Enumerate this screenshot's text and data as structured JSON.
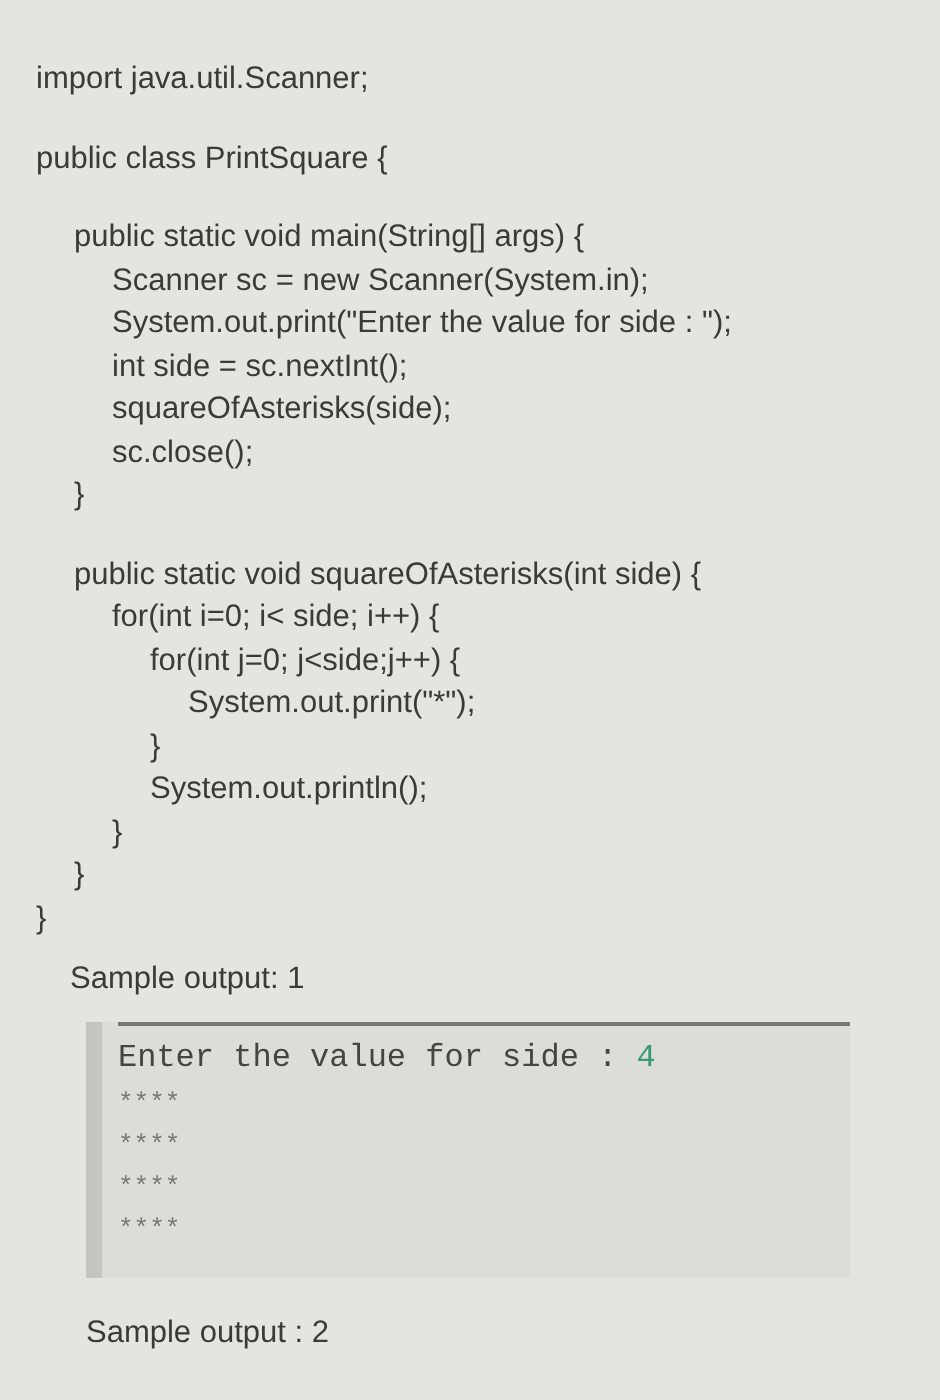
{
  "code": [
    {
      "text": "import java.util.Scanner;"
    },
    {
      "text": "public class PrintSquare {",
      "children": [
        {
          "text": "public static void main(String[] args) {",
          "children": [
            {
              "text": "Scanner sc = new Scanner(System.in);"
            },
            {
              "text": "System.out.print(\"Enter the value for side : \");"
            },
            {
              "text": "int side = sc.nextInt();"
            },
            {
              "text": "squareOfAsterisks(side);"
            },
            {
              "text": "sc.close();"
            }
          ]
        },
        {
          "text": "}"
        },
        {
          "text": "public static void squareOfAsterisks(int side) {",
          "children": [
            {
              "text": "for(int i=0; i< side; i++) {",
              "children": [
                {
                  "text": "for(int j=0; j<side;j++) {",
                  "children": [
                    {
                      "text": "System.out.print(\"*\");"
                    }
                  ]
                },
                {
                  "text": "}"
                },
                {
                  "text": "System.out.println();"
                }
              ]
            },
            {
              "text": "}"
            }
          ]
        },
        {
          "text": "}"
        }
      ]
    },
    {
      "text": "}"
    }
  ],
  "samples": [
    {
      "label": "Sample output: 1",
      "console": {
        "prompt": "Enter the value for side : ",
        "input": "4",
        "lines": [
          "****",
          "****",
          "****",
          "****"
        ]
      }
    },
    {
      "label": "Sample output : 2"
    }
  ]
}
